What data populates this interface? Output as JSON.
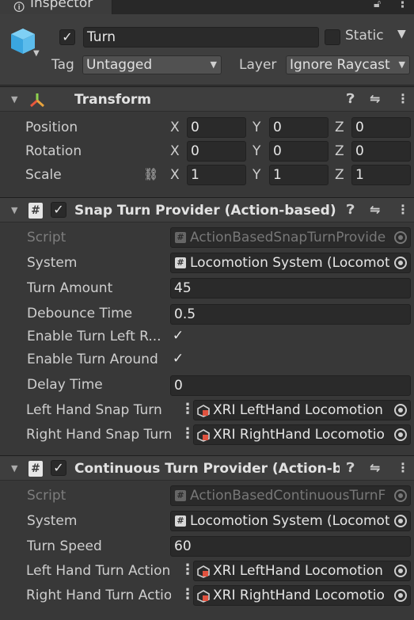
{
  "window": {
    "tab_title": "Inspector"
  },
  "gameobject": {
    "active": true,
    "name": "Turn",
    "static_label": "Static",
    "tag_label": "Tag",
    "tag_value": "Untagged",
    "layer_label": "Layer",
    "layer_value": "Ignore Raycast"
  },
  "transform": {
    "title": "Transform",
    "rows": [
      {
        "label": "Position",
        "x": "0",
        "y": "0",
        "z": "0"
      },
      {
        "label": "Rotation",
        "x": "0",
        "y": "0",
        "z": "0"
      },
      {
        "label": "Scale",
        "x": "1",
        "y": "1",
        "z": "1"
      }
    ],
    "axis_x": "X",
    "axis_y": "Y",
    "axis_z": "Z"
  },
  "snap_turn": {
    "title": "Snap Turn Provider (Action-based)",
    "script_label": "Script",
    "script_value": "ActionBasedSnapTurnProvide",
    "system_label": "System",
    "system_value": "Locomotion System (Locomot",
    "turn_amount_label": "Turn Amount",
    "turn_amount_value": "45",
    "debounce_label": "Debounce Time",
    "debounce_value": "0.5",
    "enable_left_right_label": "Enable Turn Left R...",
    "enable_left_right": true,
    "enable_around_label": "Enable Turn Around",
    "enable_around": true,
    "delay_label": "Delay Time",
    "delay_value": "0",
    "left_hand_label": "Left Hand Snap Turn",
    "left_hand_value": "XRI LeftHand Locomotion",
    "right_hand_label": "Right Hand Snap Turn",
    "right_hand_value": "XRI RightHand Locomotio"
  },
  "continuous_turn": {
    "title": "Continuous Turn Provider (Action-ba",
    "script_label": "Script",
    "script_value": "ActionBasedContinuousTurnF",
    "system_label": "System",
    "system_value": "Locomotion System (Locomot",
    "turn_speed_label": "Turn Speed",
    "turn_speed_value": "60",
    "left_hand_label": "Left Hand Turn Action",
    "left_hand_value": "XRI LeftHand Locomotion",
    "right_hand_label": "Right Hand Turn Action",
    "right_hand_value": "XRI RightHand Locomotio"
  },
  "icons": {
    "info": "ⓘ",
    "lock": "lock-icon",
    "menu": "⋮",
    "help": "❓",
    "presets": "presets-icon",
    "check": "✓",
    "fold": "▼",
    "hash": "#",
    "link": "⛓"
  }
}
